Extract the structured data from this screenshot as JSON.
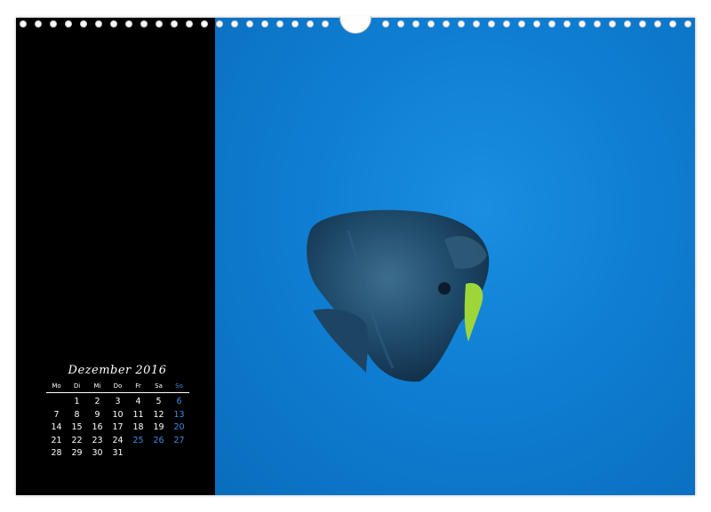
{
  "calendar": {
    "title": "Dezember 2016",
    "weekdays": [
      "Mo",
      "Di",
      "Mi",
      "Do",
      "Fr",
      "Sa",
      "So"
    ],
    "weeks": [
      [
        "",
        "1",
        "2",
        "3",
        "4",
        "5",
        "6"
      ],
      [
        "7",
        "8",
        "9",
        "10",
        "11",
        "12",
        "13"
      ],
      [
        "14",
        "15",
        "16",
        "17",
        "18",
        "19",
        "20"
      ],
      [
        "21",
        "22",
        "23",
        "24",
        "25",
        "26",
        "27"
      ],
      [
        "28",
        "29",
        "30",
        "31",
        "",
        "",
        ""
      ]
    ],
    "holidays": [
      "25",
      "26"
    ]
  },
  "photo": {
    "subject": "batfish-icon"
  },
  "colors": {
    "panel": "#000000",
    "water": "#0f7ed2",
    "highlight": "#3b8de0"
  }
}
